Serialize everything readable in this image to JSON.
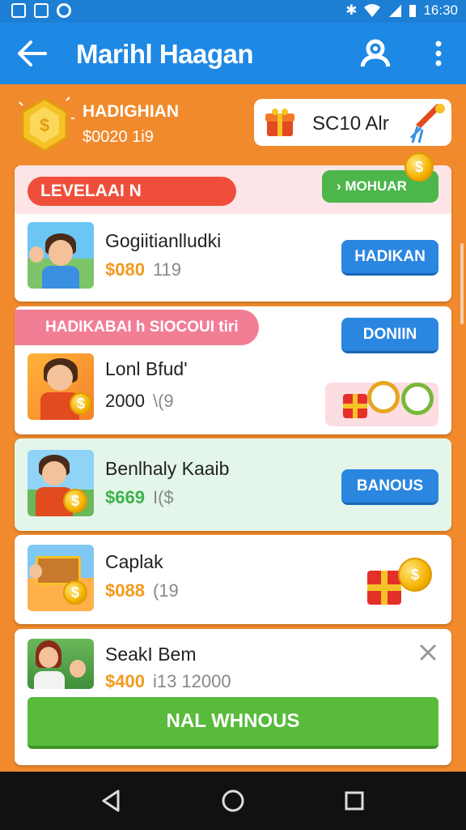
{
  "status_bar": {
    "time": "16:30"
  },
  "app_bar": {
    "title": "Marihl Haagan"
  },
  "banner": {
    "title": "HADIGHIAN",
    "subtitle": "$0020 1i9",
    "promo_label": "SC10 Alr"
  },
  "cards": [
    {
      "header_pill": "LEVELAAI N",
      "header_button": "› MOHUAR",
      "name": "Gogiitianlludki",
      "price": "$080",
      "price_suffix": "119",
      "button": "HADIKAN"
    },
    {
      "header_pill": "HADIKABAI h SIOCOUI tiri",
      "header_button": "DONIIN",
      "name": "Lonl Bfud'",
      "price": "2000",
      "price_suffix": "\\(9"
    },
    {
      "name": "Benlhaly Kaaib",
      "price": "$669",
      "price_suffix": "I($",
      "button": "BANOUS"
    },
    {
      "name": "Caplak",
      "price": "$088",
      "price_suffix": "(19"
    },
    {
      "name": "SeakI Bem",
      "price": "$400",
      "price_suffix": "i13 12000",
      "cta": "NAL WHNOUS"
    }
  ],
  "colors": {
    "app_bar": "#1e88e5",
    "background": "#f08a2c",
    "button_blue": "#2b86e0",
    "cta_green": "#58bb3c",
    "price_orange": "#f39a1e",
    "price_green": "#3db34a"
  }
}
